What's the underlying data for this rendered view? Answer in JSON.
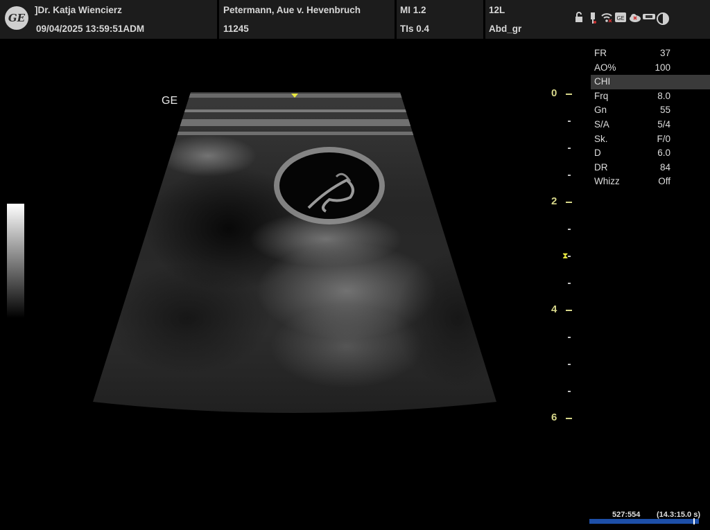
{
  "header": {
    "operator": "]Dr. Katja Wiencierz",
    "datetime": "09/04/2025 13:59:51ADM",
    "patient_name": "Petermann, Aue v. Hevenbruch",
    "patient_id": "11245",
    "mi": "MI 1.2",
    "tis": "TIs 0.4",
    "probe": "12L",
    "preset": "Abd_gr",
    "logo_text": "GE"
  },
  "status_icons": [
    "lock-icon",
    "usb-icon",
    "wifi-icon",
    "ge-network-icon",
    "cloud-error-icon",
    "connection-icon",
    "half-circle-icon"
  ],
  "image": {
    "ge_mark": "GE"
  },
  "depth_scale": {
    "labels": [
      "0",
      "2",
      "4",
      "6"
    ],
    "unit_max": 6,
    "focus_depth": 3.0
  },
  "params": [
    {
      "key": "FR",
      "value": "37"
    },
    {
      "key": "AO%",
      "value": "100"
    },
    {
      "key": "CHI",
      "value": "",
      "highlight": true
    },
    {
      "key": "Frq",
      "value": "8.0"
    },
    {
      "key": "Gn",
      "value": "55"
    },
    {
      "key": "S/A",
      "value": "5/4"
    },
    {
      "key": "Sk.",
      "value": "F/0"
    },
    {
      "key": "D",
      "value": "6.0"
    },
    {
      "key": "DR",
      "value": "84"
    },
    {
      "key": "Whizz",
      "value": "Off"
    }
  ],
  "cine": {
    "frame": "527:554",
    "time": "(14.3:15.0 s)",
    "position": 0.951
  },
  "colors": {
    "depth_scale": "#d7d78a",
    "cine_bar": "#1d4fa8",
    "focus_marker": "#e8e840"
  }
}
